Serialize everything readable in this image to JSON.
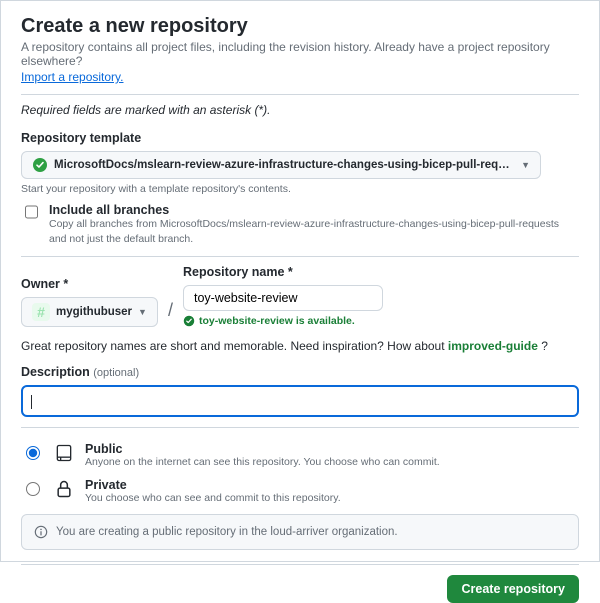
{
  "header": {
    "title": "Create a new repository",
    "intro": "A repository contains all project files, including the revision history. Already have a project repository elsewhere?",
    "import_link": "Import a repository.",
    "required_note": "Required fields are marked with an asterisk (*)."
  },
  "template": {
    "label": "Repository template",
    "selected": "MicrosoftDocs/mslearn-review-azure-infrastructure-changes-using-bicep-pull-requests",
    "hint": "Start your repository with a template repository's contents."
  },
  "include_branches": {
    "label": "Include all branches",
    "desc": "Copy all branches from MicrosoftDocs/mslearn-review-azure-infrastructure-changes-using-bicep-pull-requests and not just the default branch.",
    "checked": false
  },
  "owner": {
    "label": "Owner *",
    "value": "mygithubuser"
  },
  "repo": {
    "label": "Repository name *",
    "value": "toy-website-review",
    "available_msg": "toy-website-review is available."
  },
  "inspiration": {
    "prefix": "Great repository names are short and memorable. Need inspiration? How about ",
    "suggestion": "improved-guide",
    "suffix": " ?"
  },
  "description": {
    "label": "Description",
    "optional": "(optional)",
    "value": ""
  },
  "visibility": {
    "public": {
      "title": "Public",
      "desc": "Anyone on the internet can see this repository. You choose who can commit."
    },
    "private": {
      "title": "Private",
      "desc": "You choose who can see and commit to this repository."
    },
    "selected": "public"
  },
  "info": "You are creating a public repository in the loud-arriver organization.",
  "create_label": "Create repository"
}
